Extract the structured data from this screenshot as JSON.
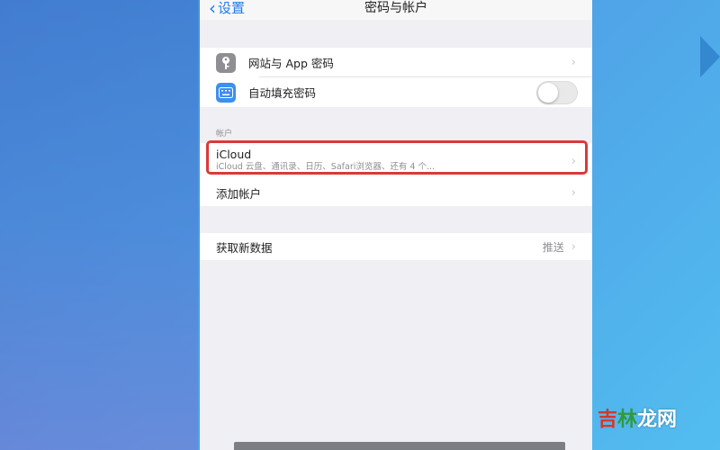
{
  "nav": {
    "back_label": "设置",
    "title": "密码与帐户"
  },
  "passwords_group": {
    "items": [
      {
        "label": "网站与 App 密码",
        "icon": "key-icon"
      },
      {
        "label": "自动填充密码",
        "icon": "keyboard-icon",
        "toggle_on": false
      }
    ]
  },
  "accounts_section": {
    "header": "帐户",
    "icloud": {
      "title": "iCloud",
      "subtitle": "iCloud 云盘、通讯录、日历、Safari浏览器、还有 4 个..."
    },
    "add_account": "添加帐户"
  },
  "fetch_group": {
    "label": "获取新数据",
    "value": "推送"
  },
  "watermark": {
    "part1": "吉",
    "part2": "林",
    "part3": "龙网"
  },
  "colors": {
    "accent": "#1e7cf5",
    "highlight": "#d93a3a"
  }
}
